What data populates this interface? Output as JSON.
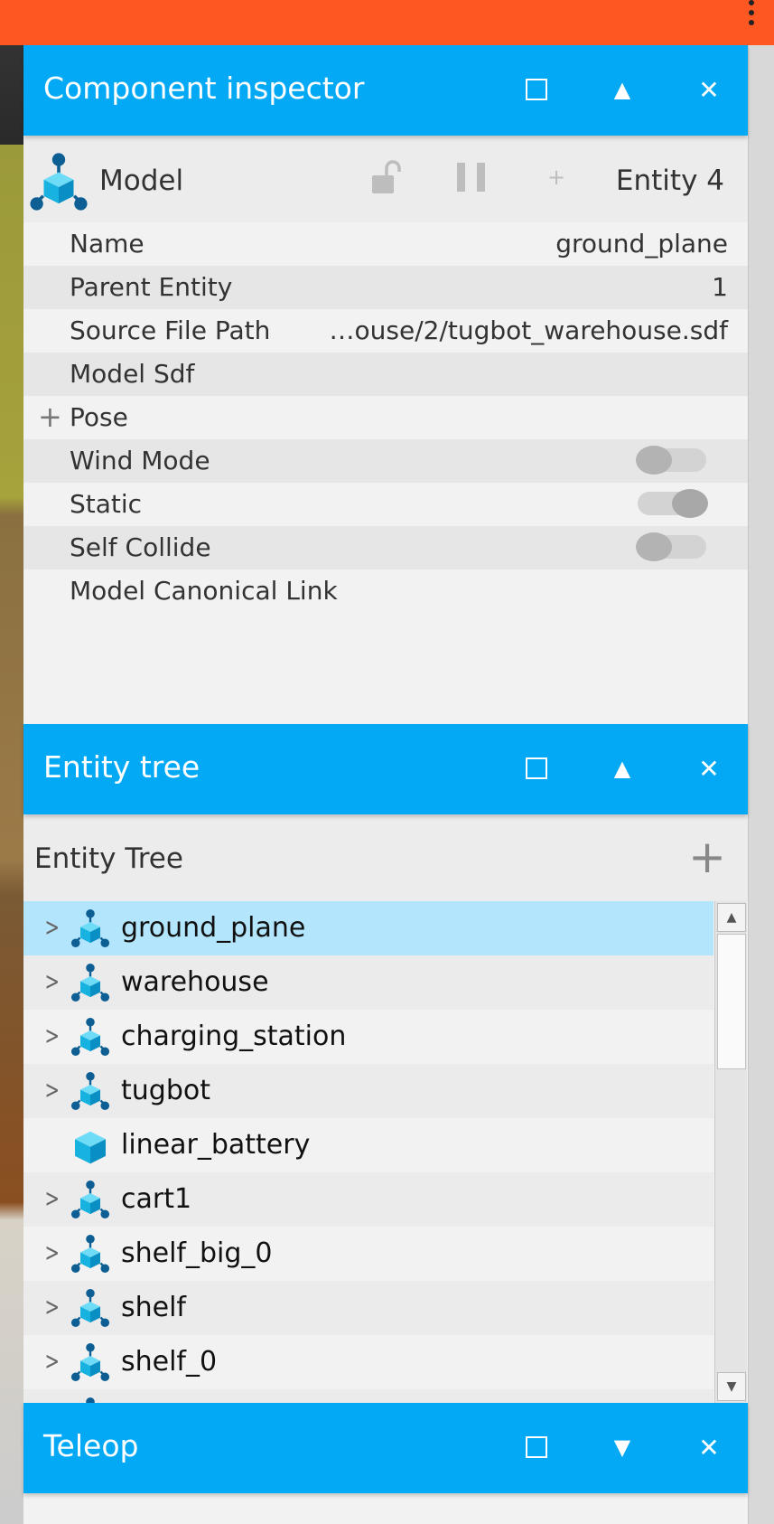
{
  "topbar": {
    "menu_icon": "kebab-menu-icon",
    "color": "#fe5722"
  },
  "inspector": {
    "title": "Component inspector",
    "buttons": {
      "maximize": "square-icon",
      "collapse": "▲",
      "close": "✕"
    },
    "model_label": "Model",
    "plus_label": "+",
    "entity_label": "Entity 4",
    "properties": [
      {
        "label": "Name",
        "value": "ground_plane"
      },
      {
        "label": "Parent Entity",
        "value": "1"
      },
      {
        "label": "Source File Path",
        "value": "…ouse/2/tugbot_warehouse.sdf"
      },
      {
        "label": "Model Sdf",
        "value": ""
      },
      {
        "label": "Pose",
        "expander": "+"
      },
      {
        "label": "Wind Mode",
        "toggle": false
      },
      {
        "label": "Static",
        "toggle": true
      },
      {
        "label": "Self Collide",
        "toggle": false
      },
      {
        "label": "Model Canonical Link",
        "value": ""
      }
    ]
  },
  "entity_tree": {
    "title": "Entity tree",
    "buttons": {
      "maximize": "square-icon",
      "collapse": "▲",
      "close": "✕"
    },
    "header_label": "Entity Tree",
    "add_label": "+",
    "items": [
      {
        "name": "ground_plane",
        "icon": "model-icon",
        "expandable": true,
        "selected": true
      },
      {
        "name": "warehouse",
        "icon": "model-icon",
        "expandable": true
      },
      {
        "name": "charging_station",
        "icon": "model-icon",
        "expandable": true
      },
      {
        "name": "tugbot",
        "icon": "model-icon",
        "expandable": true
      },
      {
        "name": "linear_battery",
        "icon": "light-cube-icon",
        "expandable": false
      },
      {
        "name": "cart1",
        "icon": "model-icon",
        "expandable": true
      },
      {
        "name": "shelf_big_0",
        "icon": "model-icon",
        "expandable": true
      },
      {
        "name": "shelf",
        "icon": "model-icon",
        "expandable": true
      },
      {
        "name": "shelf_0",
        "icon": "model-icon",
        "expandable": true
      }
    ]
  },
  "teleop": {
    "title": "Teleop",
    "buttons": {
      "maximize": "square-icon",
      "expand": "▼",
      "close": "✕"
    }
  },
  "colors": {
    "accent": "#03a9f4",
    "selected_row": "#b3e5fc",
    "topbar": "#fe5722"
  }
}
